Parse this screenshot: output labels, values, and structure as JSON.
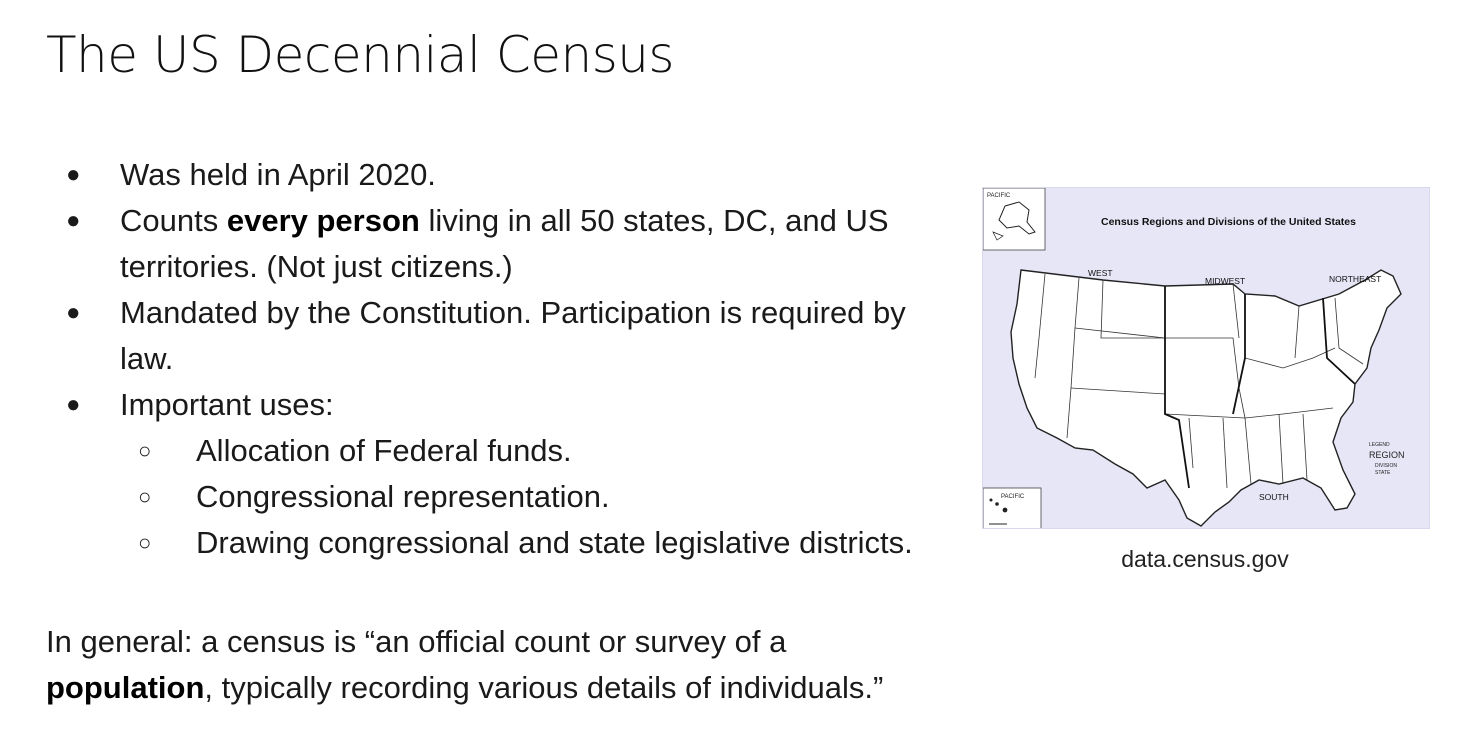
{
  "slide": {
    "title": "The US Decennial Census",
    "bullets": [
      {
        "text": "Was held in April 2020."
      },
      {
        "pre": "Counts ",
        "bold": "every person",
        "post": " living in all 50 states, DC, and US territories. (Not just citizens.)"
      },
      {
        "text": "Mandated by the Constitution. Participation is required by law."
      },
      {
        "text": "Important uses:"
      }
    ],
    "sub_bullets": [
      "Allocation of Federal funds.",
      "Congressional representation.",
      "Drawing congressional and state legislative districts."
    ],
    "summary": {
      "pre": "In general: a census is “an official count or survey of a ",
      "bold": "population",
      "post": ", typically recording various details of individuals.”"
    }
  },
  "map": {
    "title": "Census Regions and Divisions of the United States",
    "regions": [
      "WEST",
      "MIDWEST",
      "NORTHEAST",
      "SOUTH"
    ],
    "inset_labels": [
      "PACIFIC",
      "PACIFIC"
    ],
    "legend": {
      "heading": "LEGEND",
      "region": "REGION",
      "division": "DIVISION",
      "state": "STATE"
    },
    "background_color": "#e6e6f7"
  },
  "caption": "data.census.gov"
}
